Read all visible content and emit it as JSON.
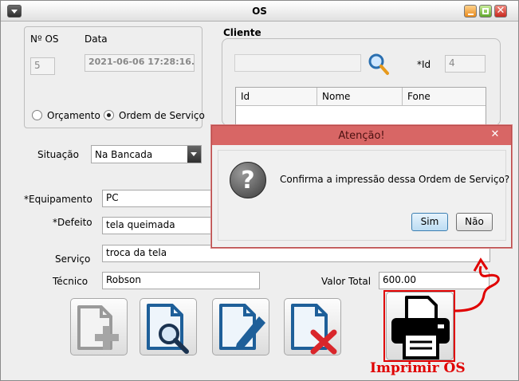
{
  "window": {
    "title": "OS"
  },
  "os_panel": {
    "num_label": "Nº OS",
    "date_label": "Data",
    "num_value": "5",
    "date_value": "2021-06-06 17:28:16.0",
    "radio_orcamento": "Orçamento",
    "radio_ordem": "Ordem de Serviço",
    "selected": "Ordem de Serviço"
  },
  "cliente": {
    "title": "Cliente",
    "search_value": "",
    "id_label": "*Id",
    "id_value": "4",
    "columns": [
      "Id",
      "Nome",
      "Fone"
    ]
  },
  "form": {
    "situacao_label": "Situação",
    "situacao_value": "Na Bancada",
    "equipamento_label": "*Equipamento",
    "equipamento_value": "PC",
    "defeito_label": "*Defeito",
    "defeito_value": "tela queimada",
    "servico_label": "Serviço",
    "servico_value": "troca da tela",
    "tecnico_label": "Técnico",
    "tecnico_value": "Robson",
    "valor_label": "Valor Total",
    "valor_value": "600.00"
  },
  "annotation": {
    "label": "Imprimir OS",
    "color": "#e00000"
  },
  "dialog": {
    "title": "Atenção!",
    "message": "Confirma a impressão dessa Ordem de Serviço?",
    "yes_label": "Sim",
    "no_label": "Não"
  },
  "colors": {
    "dialog_title": "#d86665",
    "accent_blue": "#1e5f99",
    "delete_red": "#d9262b"
  }
}
